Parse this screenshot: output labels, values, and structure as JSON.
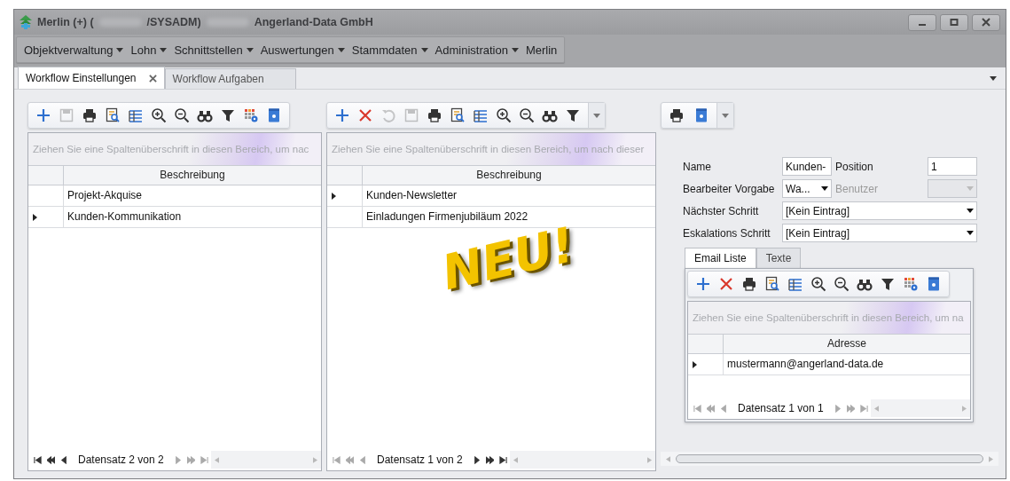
{
  "window": {
    "title": [
      {
        "kind": "text",
        "text": "Merlin (+) ("
      },
      {
        "kind": "redacted"
      },
      {
        "kind": "text",
        "text": "/SYSADM)"
      },
      {
        "kind": "redacted"
      },
      {
        "kind": "text",
        "text": "Angerland-Data GmbH"
      }
    ]
  },
  "menu": [
    {
      "label": "Objektverwaltung",
      "dropdown": true
    },
    {
      "label": "Lohn",
      "dropdown": true
    },
    {
      "label": "Schnittstellen",
      "dropdown": true
    },
    {
      "label": "Auswertungen",
      "dropdown": true
    },
    {
      "label": "Stammdaten",
      "dropdown": true
    },
    {
      "label": "Administration",
      "dropdown": true
    },
    {
      "label": "Merlin",
      "dropdown": false
    }
  ],
  "tabs": [
    {
      "label": "Workflow Einstellungen",
      "selected": true,
      "closable": true
    },
    {
      "label": "Workflow Aufgaben",
      "selected": false,
      "closable": false
    }
  ],
  "grids": [
    {
      "toolbar": [
        {
          "kind": "plus",
          "disabled": false
        },
        {
          "kind": "save",
          "disabled": true
        },
        {
          "kind": "print",
          "disabled": false
        },
        {
          "kind": "preview",
          "disabled": false
        },
        {
          "kind": "columns",
          "disabled": false
        },
        {
          "kind": "zoom-in",
          "disabled": false
        },
        {
          "kind": "zoom-out",
          "disabled": false
        },
        {
          "kind": "binoculars",
          "disabled": false
        },
        {
          "kind": "filter",
          "disabled": false
        },
        {
          "kind": "grid-gear",
          "disabled": false
        },
        {
          "kind": "help",
          "disabled": false
        }
      ],
      "toolbar_overflow": false,
      "group_hint": "Ziehen Sie eine Spaltenüberschrift in diesen Bereich, um nac",
      "column": "Beschreibung",
      "rows": [
        {
          "text": "Projekt-Akquise",
          "selected": false
        },
        {
          "text": "Kunden-Kommunikation",
          "selected": true
        }
      ],
      "navigator": {
        "text": "Datensatz 2 von 2",
        "back_enabled": true,
        "forward_enabled": false
      }
    },
    {
      "toolbar": [
        {
          "kind": "plus",
          "disabled": false
        },
        {
          "kind": "cross",
          "disabled": false
        },
        {
          "kind": "undo",
          "disabled": true
        },
        {
          "kind": "save",
          "disabled": true
        },
        {
          "kind": "print",
          "disabled": false
        },
        {
          "kind": "preview",
          "disabled": false
        },
        {
          "kind": "columns",
          "disabled": false
        },
        {
          "kind": "zoom-in",
          "disabled": false
        },
        {
          "kind": "zoom-out",
          "disabled": false
        },
        {
          "kind": "binoculars",
          "disabled": false
        },
        {
          "kind": "filter",
          "disabled": false
        }
      ],
      "toolbar_overflow": true,
      "group_hint": "Ziehen Sie eine Spaltenüberschrift in diesen Bereich, um nach dieser",
      "column": "Beschreibung",
      "rows": [
        {
          "text": "Kunden-Newsletter",
          "selected": true
        },
        {
          "text": "Einladungen Firmenjubiläum 2022",
          "selected": false
        }
      ],
      "navigator": {
        "text": "Datensatz 1 von 2",
        "back_enabled": false,
        "forward_enabled": true
      }
    }
  ],
  "stamp": "NEU!",
  "detail": {
    "toolbar": [
      {
        "kind": "print",
        "disabled": false
      },
      {
        "kind": "help",
        "disabled": false
      }
    ],
    "toolbar_overflow": true,
    "form": {
      "name": {
        "label": "Name",
        "value": "Kunden-"
      },
      "position": {
        "label": "Position",
        "value": "1"
      },
      "editor_default": {
        "label": "Bearbeiter Vorgabe",
        "value": "Wa..."
      },
      "user": {
        "label": "Benutzer",
        "disabled": true
      },
      "next_step": {
        "label": "Nächster Schritt",
        "value": "[Kein Eintrag]"
      },
      "escalation_step": {
        "label": "Eskalations Schritt",
        "value": "[Kein Eintrag]"
      }
    },
    "sub_tabs": [
      {
        "label": "Email Liste",
        "selected": true
      },
      {
        "label": "Texte",
        "selected": false
      }
    ],
    "email_grid": {
      "toolbar": [
        {
          "kind": "plus",
          "disabled": false
        },
        {
          "kind": "cross",
          "disabled": false
        },
        {
          "kind": "print",
          "disabled": false
        },
        {
          "kind": "preview",
          "disabled": false
        },
        {
          "kind": "columns",
          "disabled": false
        },
        {
          "kind": "zoom-in",
          "disabled": false
        },
        {
          "kind": "zoom-out",
          "disabled": false
        },
        {
          "kind": "binoculars",
          "disabled": false
        },
        {
          "kind": "filter",
          "disabled": false
        },
        {
          "kind": "grid-gear",
          "disabled": false
        },
        {
          "kind": "help",
          "disabled": false
        }
      ],
      "toolbar_overflow": false,
      "group_hint": "Ziehen Sie eine Spaltenüberschrift in diesen Bereich, um na",
      "column": "Adresse",
      "rows": [
        {
          "text": "mustermann@angerland-data.de",
          "selected": true
        }
      ],
      "navigator": {
        "text": "Datensatz 1 von 1",
        "back_enabled": false,
        "forward_enabled": false
      }
    }
  }
}
